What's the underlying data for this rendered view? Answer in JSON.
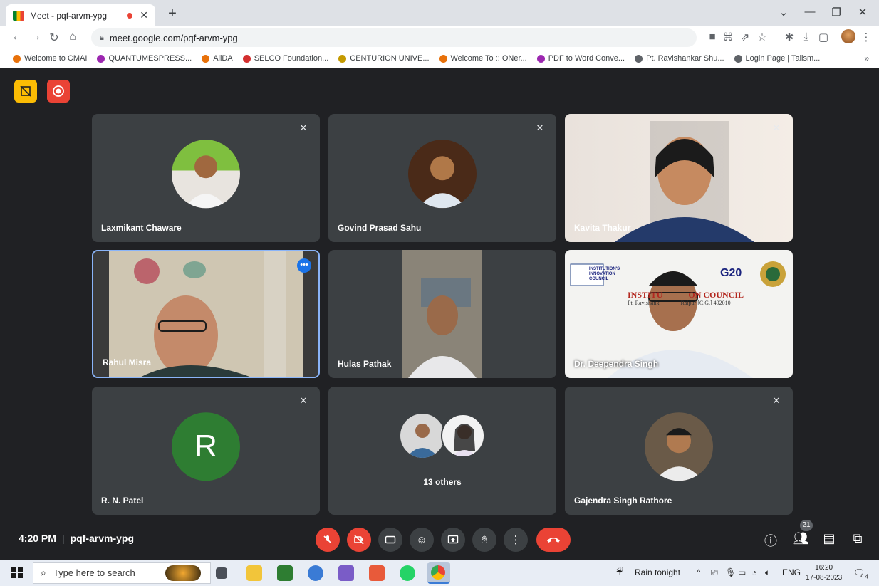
{
  "browser": {
    "tab_title": "Meet - pqf-arvm-ypg",
    "tab_close": "✕",
    "new_tab": "+",
    "url": "meet.google.com/pqf-arvm-ypg",
    "bookmarks": [
      {
        "label": "Welcome to CMAI",
        "color": "#e8710a"
      },
      {
        "label": "QUANTUMESPRESS...",
        "color": "#9c27b0"
      },
      {
        "label": "AiiDA",
        "color": "#e8710a"
      },
      {
        "label": "SELCO Foundation...",
        "color": "#d32f2f"
      },
      {
        "label": "CENTURION UNIVE...",
        "color": "#c49a00"
      },
      {
        "label": "Welcome To :: ONer...",
        "color": "#e8710a"
      },
      {
        "label": "PDF to Word Conve...",
        "color": "#9c27b0"
      },
      {
        "label": "Pt. Ravishankar Shu...",
        "color": "#5f6368"
      },
      {
        "label": "Login Page | Talism...",
        "color": "#5f6368"
      }
    ],
    "bookmarks_more": "»"
  },
  "participants": [
    {
      "name": "Laxmikant Chaware",
      "kind": "avatar",
      "muted": true
    },
    {
      "name": "Govind Prasad Sahu",
      "kind": "avatar",
      "muted": true
    },
    {
      "name": "Kavita Thakur",
      "kind": "video",
      "muted": true
    },
    {
      "name": "Rahul Misra",
      "kind": "video",
      "muted": false,
      "active": true
    },
    {
      "name": "Hulas Pathak",
      "kind": "video",
      "muted": false
    },
    {
      "name": "Dr. Deependra Singh",
      "kind": "video",
      "muted": true
    },
    {
      "name": "R. N. Patel",
      "kind": "initial",
      "initial": "R",
      "muted": true
    },
    {
      "name": "13 others",
      "kind": "group",
      "muted": false
    },
    {
      "name": "Gajendra Singh Rathore",
      "kind": "avatar",
      "muted": true
    }
  ],
  "slide": {
    "council_line": "INSTITUTION'S INNOVATION COUNCIL",
    "heading": "INSTITU            ON COUNCIL",
    "sub": "Pt. Ravishank               Raipur [C.G.] 492010",
    "g20": "G20"
  },
  "meeting": {
    "time": "4:20 PM",
    "separator": "|",
    "code": "pqf-arvm-ypg",
    "participant_count": "21"
  },
  "taskbar": {
    "search_placeholder": "Type here to search",
    "weather": "Rain tonight",
    "language": "ENG",
    "time": "16:20",
    "date": "17-08-2023",
    "notifications": "4"
  },
  "colors": {
    "meet_bg": "#202124",
    "tile_bg": "#3c4043",
    "red": "#ea4335",
    "active_border": "#8ab4f8",
    "initial_avatar": "#2e7d32"
  }
}
